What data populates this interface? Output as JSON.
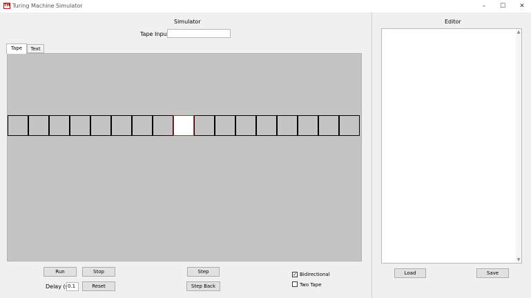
{
  "window": {
    "icon_text": "TM",
    "title": "Turing Machine Simulator",
    "minimize": "–",
    "maximize": "☐",
    "close": "✕"
  },
  "simulator": {
    "title": "Simulator",
    "tape_input_label": "Tape Input:",
    "tape_input_value": "",
    "tabs": [
      {
        "label": "Tape",
        "active": true
      },
      {
        "label": "Text",
        "active": false
      }
    ],
    "tape_cells": [
      "",
      "",
      "",
      "",
      "",
      "",
      "",
      "",
      "",
      "",
      "",
      "",
      "",
      "",
      "",
      "",
      ""
    ],
    "head_index": 8
  },
  "controls": {
    "run": "Run",
    "stop": "Stop",
    "step": "Step",
    "step_back": "Step Back",
    "reset": "Reset",
    "delay_label": "Delay (s)",
    "delay_value": "0.1",
    "bidirectional_label": "Bidirectional",
    "bidirectional_checked": true,
    "two_tape_label": "Two Tape",
    "two_tape_checked": false
  },
  "editor": {
    "title": "Editor",
    "content": "",
    "load": "Load",
    "save": "Save"
  }
}
